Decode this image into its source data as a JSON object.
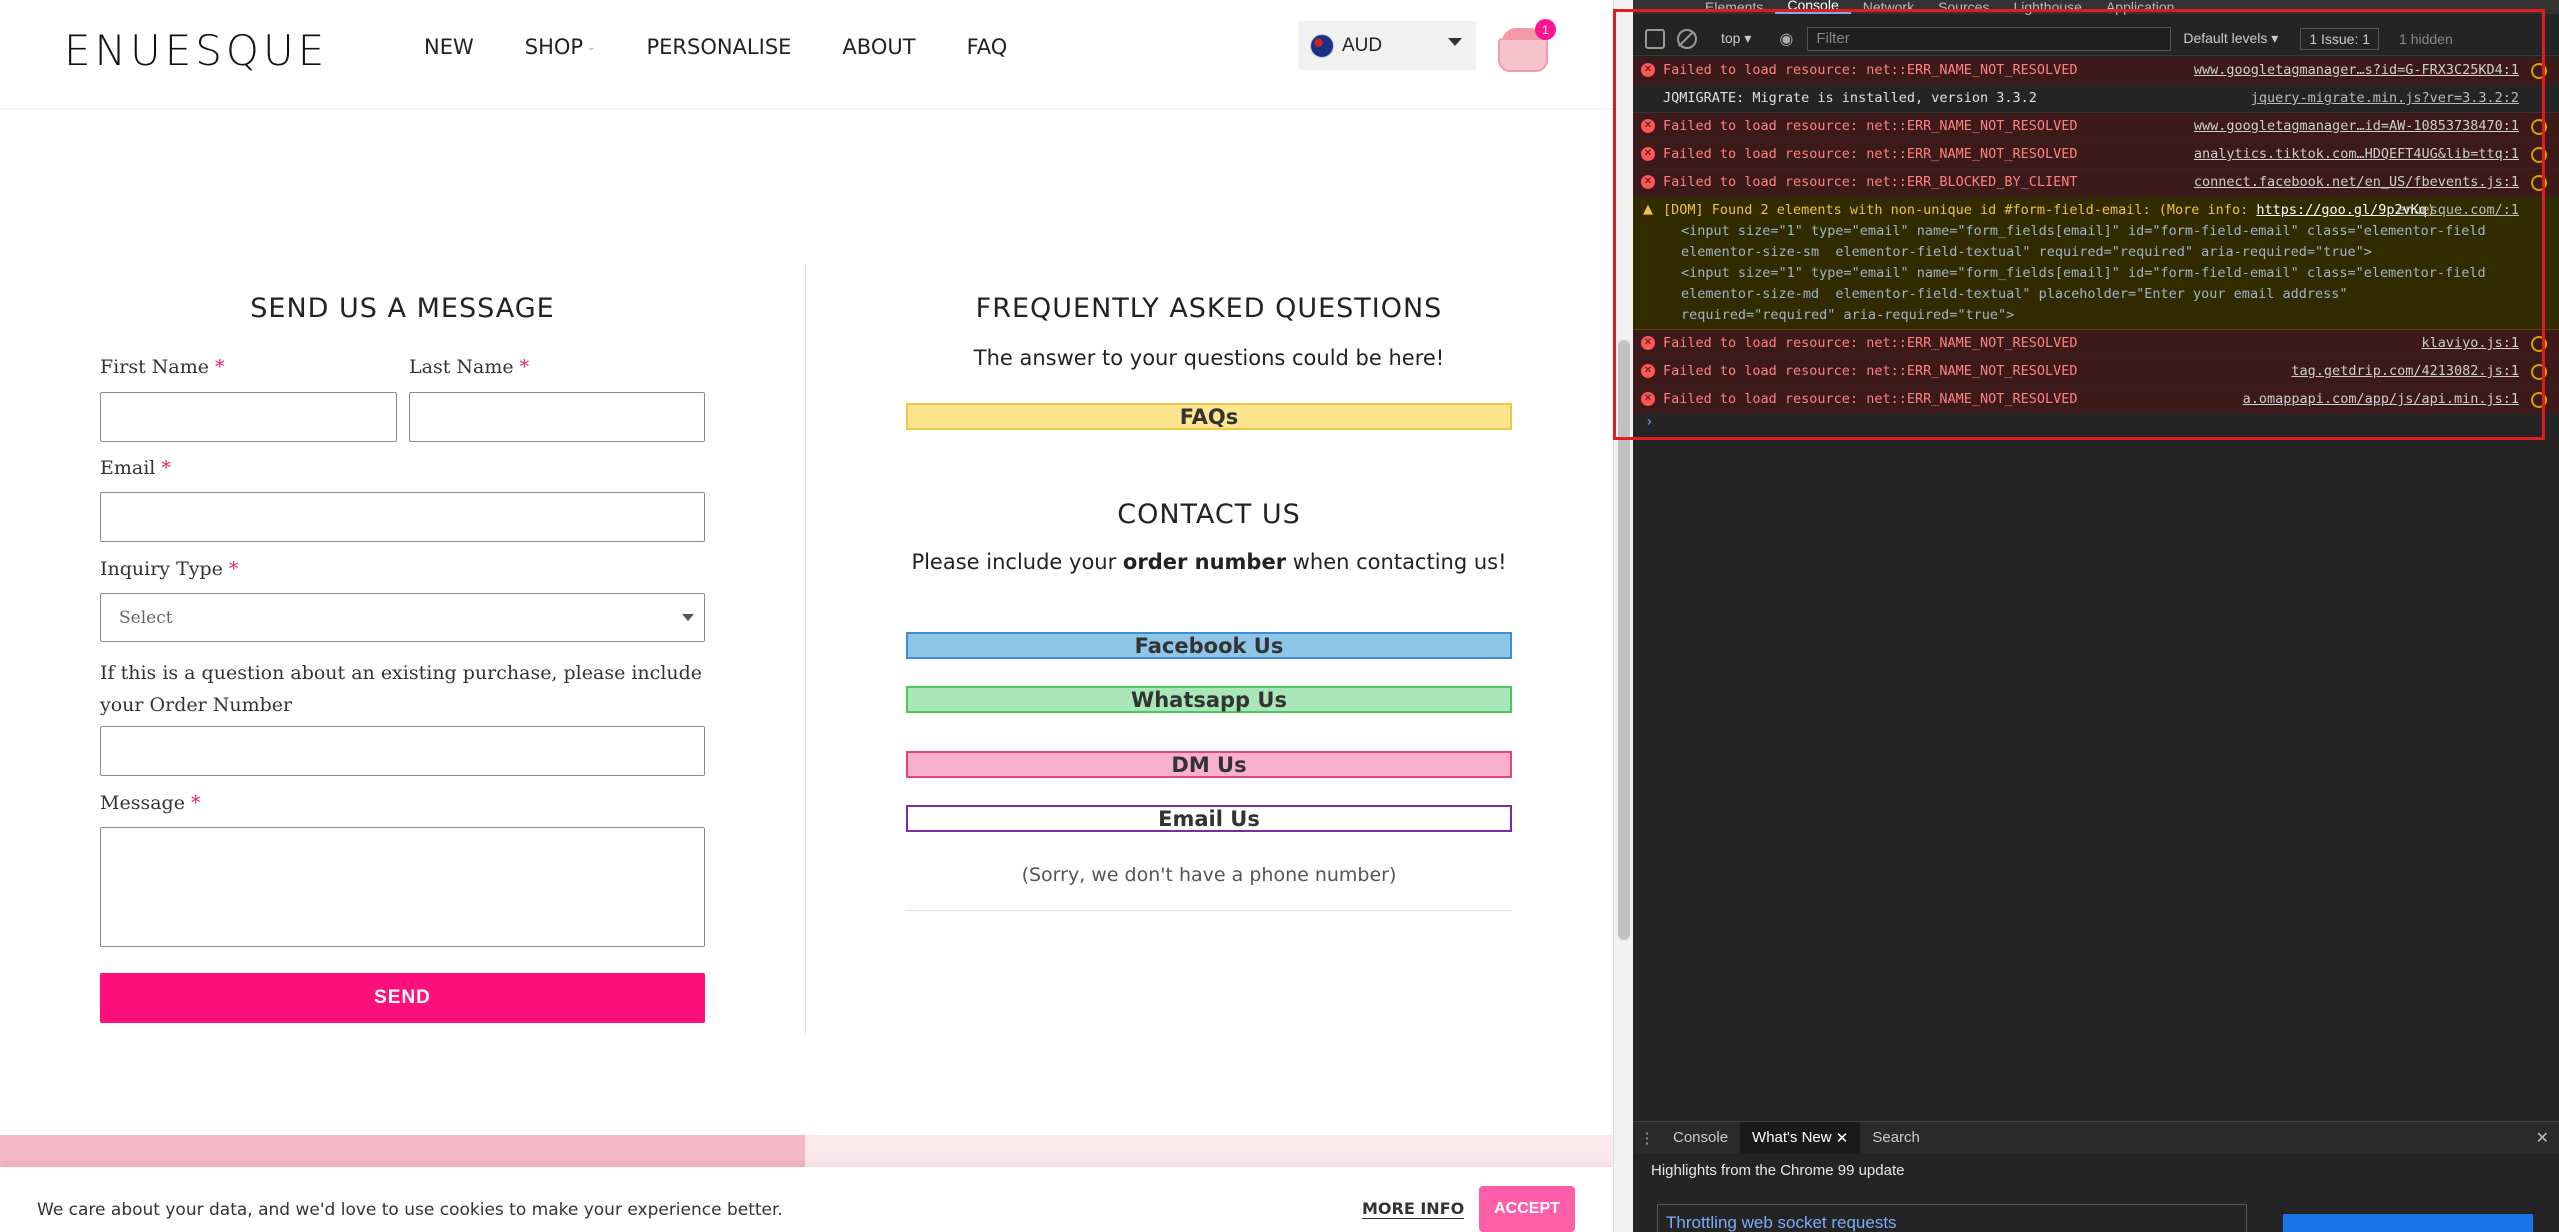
{
  "site": {
    "logo": "ENUESQUE",
    "nav": [
      "NEW",
      "SHOP",
      "PERSONALISE",
      "ABOUT",
      "FAQ"
    ],
    "currency": "AUD",
    "cart_count": "1",
    "form": {
      "title": "SEND US A MESSAGE",
      "first_name_label": "First Name",
      "last_name_label": "Last Name",
      "email_label": "Email",
      "inquiry_label": "Inquiry Type",
      "inquiry_placeholder": "Select",
      "order_label": "If this is a question about an existing purchase, please include your Order Number",
      "message_label": "Message",
      "required_mark": "*",
      "send_label": "SEND"
    },
    "faq": {
      "title": "FREQUENTLY ASKED QUESTIONS",
      "subtitle": "The answer to your questions could be here!",
      "button": "FAQs"
    },
    "contact": {
      "title": "CONTACT US",
      "note_pre": "Please include your ",
      "note_bold": "order number",
      "note_post": " when contacting us!",
      "buttons": [
        {
          "label": "Facebook Us",
          "bg": "#8ec6e8",
          "border": "#3b8fd0"
        },
        {
          "label": "Whatsapp Us",
          "bg": "#a9e6b8",
          "border": "#4cc85a"
        },
        {
          "label": "DM Us",
          "bg": "#f8b0cc",
          "border": "#e0457f"
        },
        {
          "label": "Email Us",
          "bg": "#ffffff",
          "border": "#7a2aa8"
        }
      ],
      "phone_note": "(Sorry, we don't have a phone number)"
    },
    "cookie": {
      "text": "We care about your data, and we'd love to use cookies to make your experience better.",
      "more_info": "MORE INFO",
      "accept": "ACCEPT"
    },
    "colors": {
      "accent": "#ff0f7b",
      "faq_button": "#fde58d"
    }
  },
  "devtools": {
    "tabs": [
      "Elements",
      "Console",
      "Network",
      "Sources",
      "Lighthouse",
      "Application"
    ],
    "active_tab": "Console",
    "toolbar": {
      "context": "top ▾",
      "filter_placeholder": "Filter",
      "levels": "Default levels ▾",
      "issues": "1 Issue: 1",
      "hidden": "1 hidden"
    },
    "messages": [
      {
        "type": "err",
        "text": "Failed to load resource: net::ERR_NAME_NOT_RESOLVED",
        "src": "www.googletagmanager…s?id=G-FRX3C25KD4:1"
      },
      {
        "type": "info",
        "text": "JQMIGRATE: Migrate is installed, version 3.3.2",
        "src": "jquery-migrate.min.js?ver=3.3.2:2"
      },
      {
        "type": "err",
        "text": "Failed to load resource: net::ERR_NAME_NOT_RESOLVED",
        "src": "www.googletagmanager…id=AW-10853738470:1"
      },
      {
        "type": "err",
        "text": "Failed to load resource: net::ERR_NAME_NOT_RESOLVED",
        "src": "analytics.tiktok.com…HDQEFT4UG&lib=ttq:1"
      },
      {
        "type": "err",
        "text": "Failed to load resource: net::ERR_BLOCKED_BY_CLIENT",
        "src": "connect.facebook.net/en_US/fbevents.js:1"
      },
      {
        "type": "err",
        "text": "Failed to load resource: net::ERR_NAME_NOT_RESOLVED",
        "src": "klaviyo.js:1"
      },
      {
        "type": "err",
        "text": "Failed to load resource: net::ERR_NAME_NOT_RESOLVED",
        "src": "tag.getdrip.com/4213082.js:1"
      },
      {
        "type": "err",
        "text": "Failed to load resource: net::ERR_NAME_NOT_RESOLVED",
        "src": "a.omappapi.com/app/js/api.min.js:1"
      }
    ],
    "warning": {
      "text": "[DOM] Found 2 elements with non-unique id #form-field-email: (More info: ",
      "link": "https://goo.gl/9p2vKq",
      "close": ")",
      "src": "enuesque.com/:1",
      "code1": "<input size=\"1\" type=\"email\" name=\"form_fields[email]\" id=\"form-field-email\" class=\"elementor-field elementor-size-sm  elementor-field-textual\" required=\"required\" aria-required=\"true\">",
      "code2": "<input size=\"1\" type=\"email\" name=\"form_fields[email]\" id=\"form-field-email\" class=\"elementor-field elementor-size-md  elementor-field-textual\" placeholder=\"Enter your email address\" required=\"required\" aria-required=\"true\">"
    },
    "drawer": {
      "tabs": [
        "Console",
        "What's New",
        "Search"
      ],
      "whatsnew_title": "Highlights from the Chrome 99 update",
      "card_title": "Throttling web socket requests"
    }
  }
}
